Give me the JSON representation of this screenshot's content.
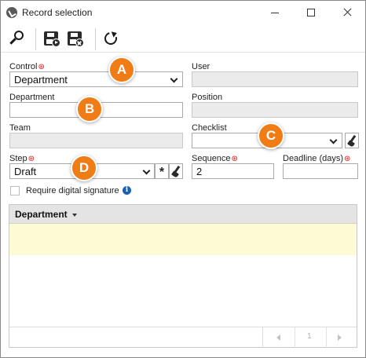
{
  "window": {
    "title": "Record selection"
  },
  "form": {
    "control": {
      "label": "Control",
      "value": "Department"
    },
    "user": {
      "label": "User",
      "value": ""
    },
    "department": {
      "label": "Department",
      "value": ""
    },
    "position": {
      "label": "Position",
      "value": ""
    },
    "team": {
      "label": "Team",
      "value": ""
    },
    "checklist": {
      "label": "Checklist",
      "value": ""
    },
    "step": {
      "label": "Step",
      "value": "Draft",
      "asterisk": "*"
    },
    "sequence": {
      "label": "Sequence",
      "value": "2"
    },
    "deadline": {
      "label": "Deadline (days)",
      "value": ""
    },
    "signature": {
      "label": "Require digital signature",
      "checked": false,
      "info": "i"
    }
  },
  "required_marker": "⊛",
  "callouts": [
    "A",
    "B",
    "C",
    "D"
  ],
  "grid": {
    "columns": [
      "Department"
    ],
    "rows": [],
    "pager": {
      "page": "1"
    }
  },
  "icons": {
    "toolbar": [
      "search-icon",
      "save-and-run-icon",
      "save-and-close-icon",
      "refresh-icon"
    ]
  },
  "colors": {
    "callout": "#f07c16",
    "required": "#dd1111",
    "row_highlight": "#fdfbd4",
    "grid_header": "#e4e4e4"
  }
}
